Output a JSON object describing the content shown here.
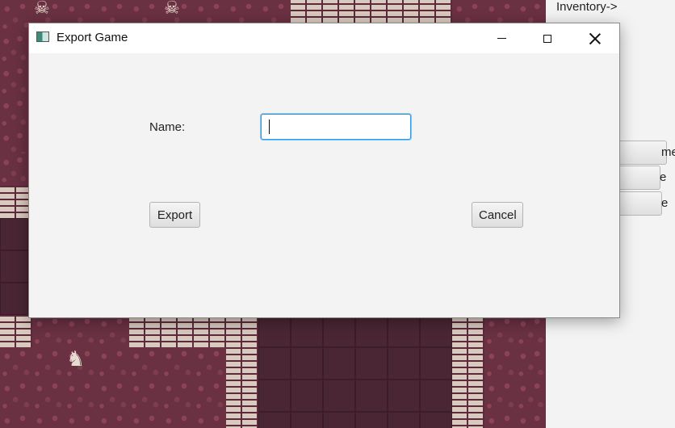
{
  "side_panel": {
    "inventory_label": "Inventory->",
    "buttons": [
      "me",
      "e",
      "e"
    ]
  },
  "dialog": {
    "title": "Export Game",
    "name_label": "Name:",
    "name_value": "",
    "export_label": "Export",
    "cancel_label": "Cancel"
  },
  "icons": {
    "app": "app-window-icon",
    "minimize": "minimize-icon",
    "maximize": "maximize-icon",
    "close": "close-icon",
    "skeleton": "skeleton-icon",
    "player": "player-knight-icon"
  },
  "colors": {
    "map_floor": "#4a2634",
    "map_rubble": "#6a3143",
    "map_brick": "#d9c9bf",
    "input_focus": "#3a9ad9",
    "dialog_bg": "#f3f3f3"
  }
}
